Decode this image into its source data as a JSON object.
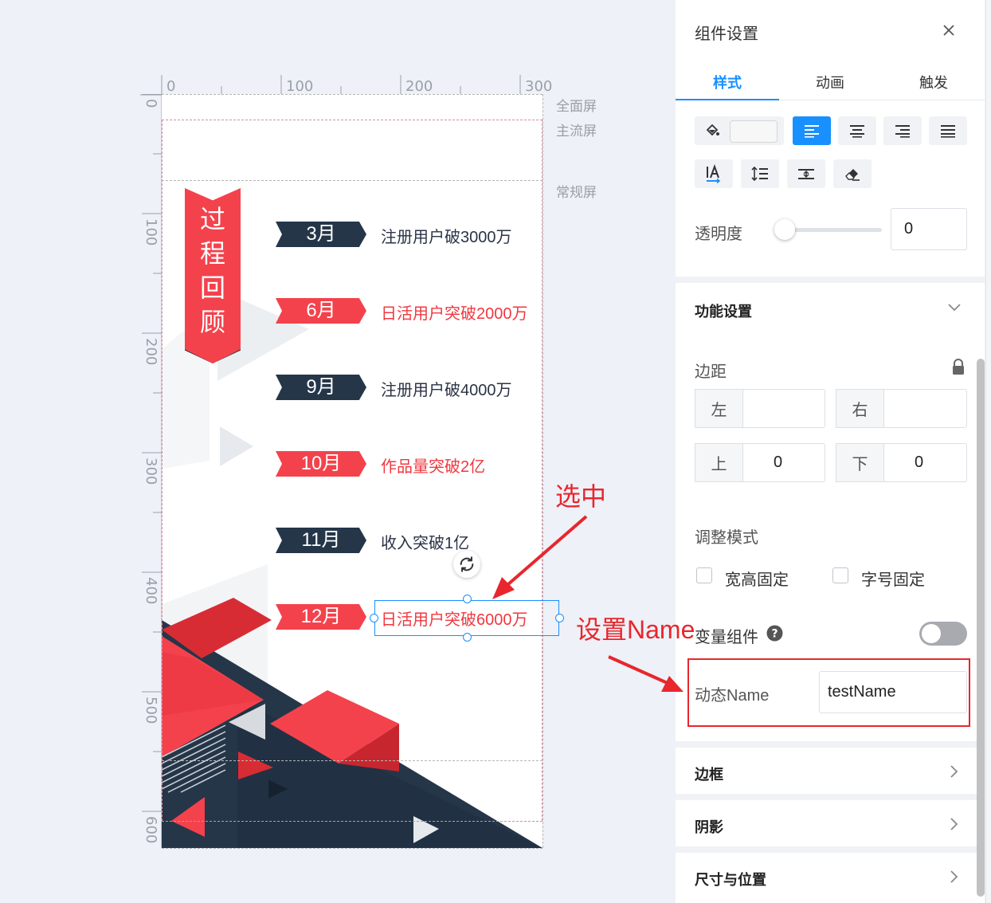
{
  "ruler": {
    "top_ticks": [
      "0",
      "100",
      "200",
      "300"
    ],
    "left_ticks": [
      "0",
      "100",
      "200",
      "300",
      "400",
      "500",
      "600"
    ]
  },
  "screens": {
    "full": "全面屏",
    "main": "主流屏",
    "normal": "常规屏"
  },
  "poster": {
    "banner_text": "过程回顾",
    "timeline": [
      {
        "month": "3月",
        "text": "注册用户破3000万",
        "style": "navy"
      },
      {
        "month": "6月",
        "text": "日活用户突破2000万",
        "style": "red"
      },
      {
        "month": "9月",
        "text": "注册用户破4000万",
        "style": "navy"
      },
      {
        "month": "10月",
        "text": "作品量突破2亿",
        "style": "red"
      },
      {
        "month": "11月",
        "text": "收入突破1亿",
        "style": "navy"
      },
      {
        "month": "12月",
        "text": "日活用户突破6000万",
        "style": "red"
      }
    ]
  },
  "annotations": {
    "selected": "选中",
    "set_name": "设置Name"
  },
  "panel": {
    "title": "组件设置",
    "close_icon": "close-icon",
    "tabs": [
      {
        "label": "样式",
        "active": true
      },
      {
        "label": "动画",
        "active": false
      },
      {
        "label": "触发",
        "active": false
      }
    ],
    "opacity_label": "透明度",
    "opacity_value": "0",
    "opacity_level": 0,
    "function_section": "功能设置",
    "margin_label": "边距",
    "margin": {
      "left_label": "左",
      "left_value": "",
      "right_label": "右",
      "right_value": "",
      "top_label": "上",
      "top_value": "0",
      "bottom_label": "下",
      "bottom_value": "0"
    },
    "adjust_mode_label": "调整模式",
    "adjust_options": [
      {
        "label": "宽高固定",
        "checked": false
      },
      {
        "label": "字号固定",
        "checked": false
      }
    ],
    "variable_component_label": "变量组件",
    "variable_component_on": false,
    "dynamic_name_label": "动态Name",
    "dynamic_name_value": "testName",
    "sections": [
      "边框",
      "阴影",
      "尺寸与位置"
    ]
  },
  "colors": {
    "accent": "#1890ff",
    "poster_red": "#f4424c",
    "poster_navy": "#253649",
    "annotation_red": "#e8262d"
  }
}
